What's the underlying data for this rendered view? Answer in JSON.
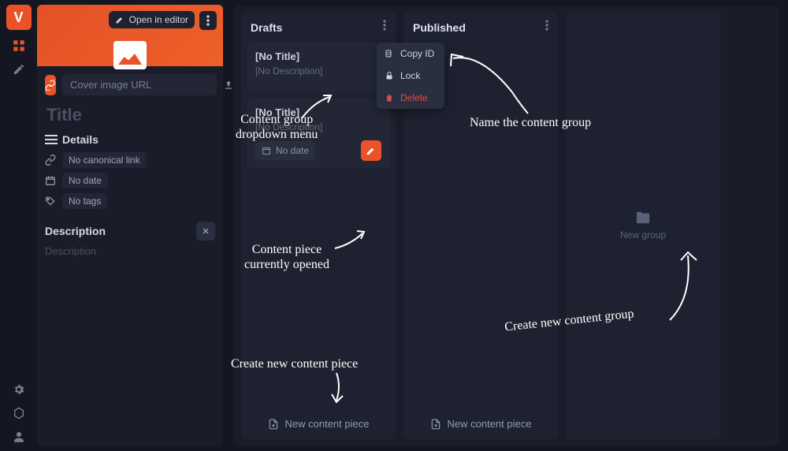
{
  "hero": {
    "open_in_editor": "Open in editor"
  },
  "url_row": {
    "placeholder": "Cover image URL"
  },
  "title_placeholder": "Title",
  "details": {
    "header": "Details",
    "canonical": "No canonical link",
    "date": "No date",
    "tags": "No tags"
  },
  "description": {
    "header": "Description",
    "placeholder": "Description"
  },
  "columns": [
    {
      "title": "Drafts",
      "cards": [
        {
          "title": "[No Title]",
          "desc": "[No Description]"
        },
        {
          "title": "[No Title]",
          "desc": "[No Description]",
          "date": "No date"
        }
      ],
      "footer": "New content piece"
    },
    {
      "title": "Published",
      "cards": [],
      "footer": "New content piece"
    }
  ],
  "dropdown": {
    "copy_id": "Copy ID",
    "lock": "Lock",
    "delete": "Delete"
  },
  "newgroup_label": "New group",
  "annotations": {
    "dropdown": "Content group\ndropdown menu",
    "opened": "Content piece\ncurrently opened",
    "new_piece": "Create new content piece",
    "name_group": "Name the content group",
    "new_group": "Create new content group"
  }
}
